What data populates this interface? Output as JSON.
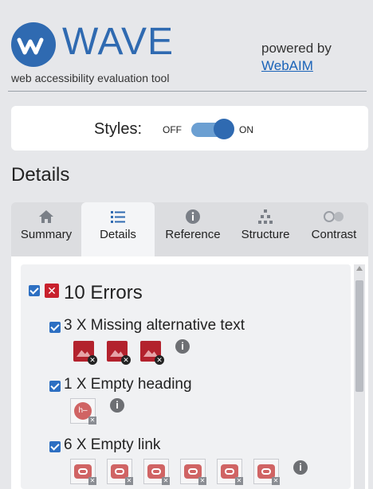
{
  "header": {
    "logo_text": "WAVE",
    "tagline": "web accessibility evaluation tool",
    "powered_by": "powered by",
    "powered_link": "WebAIM"
  },
  "styles": {
    "label": "Styles:",
    "off": "OFF",
    "on": "ON",
    "state": "on"
  },
  "section_title": "Details",
  "tabs": [
    {
      "label": "Summary",
      "icon": "home-icon",
      "active": false
    },
    {
      "label": "Details",
      "icon": "list-icon",
      "active": true
    },
    {
      "label": "Reference",
      "icon": "info-icon",
      "active": false
    },
    {
      "label": "Structure",
      "icon": "structure-icon",
      "active": false
    },
    {
      "label": "Contrast",
      "icon": "contrast-icon",
      "active": false
    }
  ],
  "errors": {
    "title": "10 Errors",
    "groups": [
      {
        "label": "3 X Missing alternative text",
        "icon": "missing-alt-icon"
      },
      {
        "label": "1 X Empty heading",
        "icon": "empty-heading-icon"
      },
      {
        "label": "6 X Empty link",
        "icon": "empty-link-icon"
      }
    ]
  },
  "colors": {
    "brand": "#2f6ab1",
    "error": "#c8202c",
    "checkbox": "#2d6fc2"
  }
}
